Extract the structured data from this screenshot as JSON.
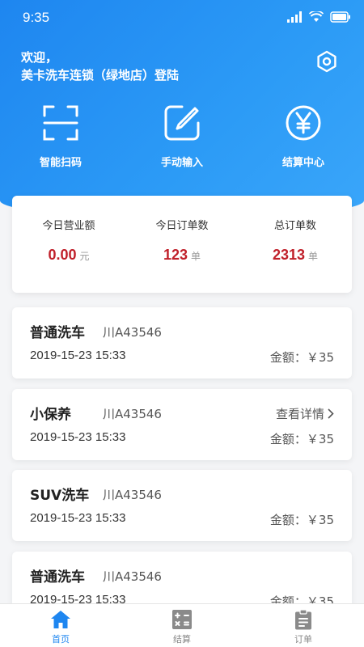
{
  "status": {
    "time": "9:35"
  },
  "header": {
    "welcome_line1": "欢迎，",
    "welcome_line2": "美卡洗车连锁（绿地店）登陆"
  },
  "actions": [
    {
      "label": "智能扫码",
      "icon": "scan-icon"
    },
    {
      "label": "手动输入",
      "icon": "edit-icon"
    },
    {
      "label": "结算中心",
      "icon": "yen-icon"
    }
  ],
  "stats": [
    {
      "label": "今日营业额",
      "value": "0.00",
      "unit": "元"
    },
    {
      "label": "今日订单数",
      "value": "123",
      "unit": "单"
    },
    {
      "label": "总订单数",
      "value": "2313",
      "unit": "单"
    }
  ],
  "orders": [
    {
      "title": "普通洗车",
      "plate": "川A43546",
      "date": "2019-15-23 15:33",
      "amount": "金额：￥35"
    },
    {
      "title": "小保养",
      "plate": "川A43546",
      "date": "2019-15-23 15:33",
      "amount": "金额：￥35",
      "detail": "查看详情"
    },
    {
      "title": "SUV洗车",
      "plate": "川A43546",
      "date": "2019-15-23 15:33",
      "amount": "金额：￥35"
    },
    {
      "title": "普通洗车",
      "plate": "川A43546",
      "date": "2019-15-23 15:33",
      "amount": "金额：￥35"
    }
  ],
  "tabs": [
    {
      "label": "首页",
      "icon": "home-icon",
      "active": true
    },
    {
      "label": "结算",
      "icon": "calculator-icon"
    },
    {
      "label": "订单",
      "icon": "clipboard-icon"
    }
  ],
  "colors": {
    "primary": "#1e86f0",
    "accent": "#c0202a"
  }
}
